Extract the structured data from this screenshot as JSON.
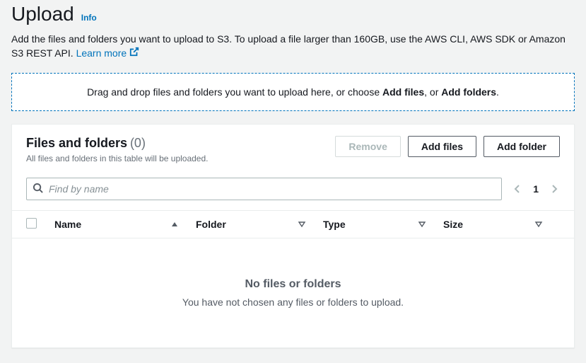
{
  "header": {
    "title": "Upload",
    "info_label": "Info"
  },
  "description": {
    "prefix": "Add the files and folders you want to upload to S3. To upload a file larger than 160GB, use the AWS CLI, AWS SDK or Amazon S3 REST API. ",
    "learn_more": "Learn more"
  },
  "dropzone": {
    "prefix": "Drag and drop files and folders you want to upload here, or choose ",
    "add_files": "Add files",
    "sep": ", or ",
    "add_folders": "Add folders",
    "suffix": "."
  },
  "panel": {
    "title": "Files and folders",
    "count": "(0)",
    "subtitle": "All files and folders in this table will be uploaded.",
    "actions": {
      "remove": "Remove",
      "add_files": "Add files",
      "add_folder": "Add folder"
    },
    "search": {
      "placeholder": "Find by name"
    },
    "pager": {
      "page": "1"
    },
    "columns": {
      "name": "Name",
      "folder": "Folder",
      "type": "Type",
      "size": "Size"
    },
    "empty": {
      "title": "No files or folders",
      "subtitle": "You have not chosen any files or folders to upload."
    }
  }
}
